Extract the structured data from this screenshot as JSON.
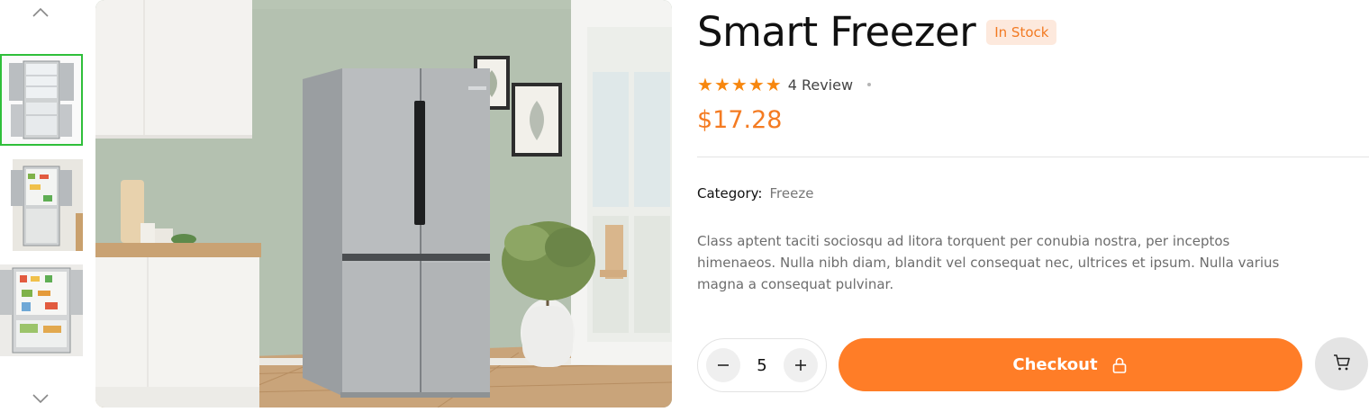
{
  "gallery": {
    "thumbnails": [
      {
        "icon": "fridge-open-empty-image",
        "selected": true
      },
      {
        "icon": "fridge-open-stocked-image",
        "selected": false
      },
      {
        "icon": "fridge-open-full-image",
        "selected": false
      }
    ],
    "main_image": "french-door-fridge-kitchen-image",
    "nav_up_icon": "chevron-up-icon",
    "nav_down_icon": "chevron-down-icon"
  },
  "product": {
    "title": "Smart Freezer",
    "stock_badge": "In Stock",
    "rating": 5,
    "review_text": "4 Review",
    "price": "$17.28",
    "category_label": "Category:",
    "category_value": "Freeze",
    "description": "Class aptent taciti sociosqu ad litora torquent per conubia nostra, per inceptos himenaeos. Nulla nibh diam, blandit vel consequat nec, ultrices et ipsum. Nulla varius magna a consequat pulvinar."
  },
  "actions": {
    "quantity": "5",
    "minus_icon": "minus-icon",
    "plus_icon": "plus-icon",
    "checkout_label": "Checkout",
    "checkout_icon": "lock-icon",
    "cart_icon": "cart-icon"
  },
  "colors": {
    "accent": "#ff7d27",
    "price": "#f47b22",
    "star": "#f7870f",
    "badge_bg": "#fde9dd",
    "selected_thumb_border": "#2fbf3a"
  }
}
